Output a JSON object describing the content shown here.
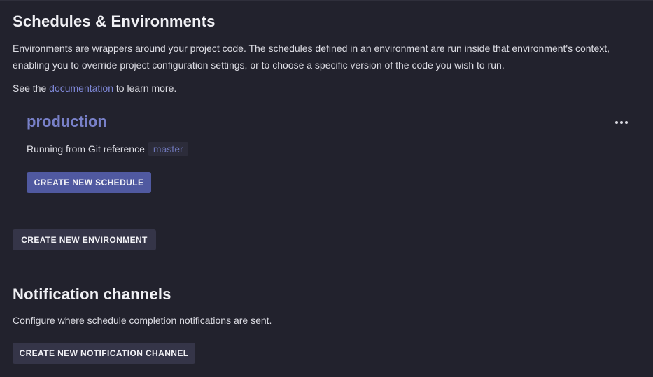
{
  "schedules": {
    "title": "Schedules & Environments",
    "description": "Environments are wrappers around your project code. The schedules defined in an environment are run inside that environment's context, enabling you to override project configuration settings, or to choose a specific version of the code you wish to run.",
    "doc_prefix": "See the ",
    "doc_link": "documentation",
    "doc_suffix": " to learn more."
  },
  "environment": {
    "name": "production",
    "git_label": "Running from Git reference",
    "git_ref": "master",
    "create_schedule_label": "CREATE NEW SCHEDULE",
    "more_icon": "more-horizontal-icon"
  },
  "create_environment_label": "CREATE NEW ENVIRONMENT",
  "notifications": {
    "title": "Notification channels",
    "description": "Configure where schedule completion notifications are sent.",
    "create_label": "CREATE NEW NOTIFICATION CHANNEL"
  },
  "colors": {
    "background": "#22222d",
    "accent": "#7880c8",
    "primary_button": "#5059a0",
    "secondary_button": "#353548",
    "link": "#7e87d6"
  }
}
